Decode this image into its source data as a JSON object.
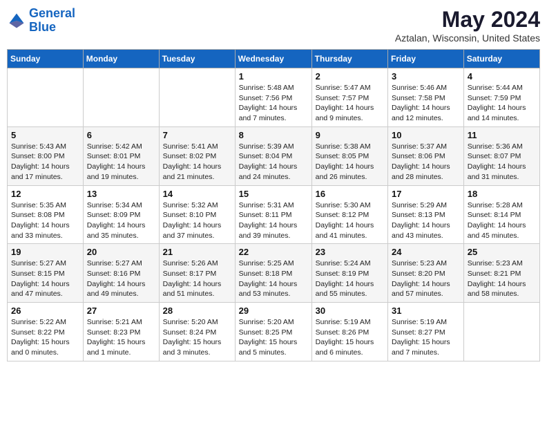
{
  "logo": {
    "line1": "General",
    "line2": "Blue"
  },
  "title": "May 2024",
  "location": "Aztalan, Wisconsin, United States",
  "days_of_week": [
    "Sunday",
    "Monday",
    "Tuesday",
    "Wednesday",
    "Thursday",
    "Friday",
    "Saturday"
  ],
  "weeks": [
    [
      null,
      null,
      null,
      {
        "day": "1",
        "sunrise": "5:48 AM",
        "sunset": "7:56 PM",
        "daylight": "14 hours and 7 minutes."
      },
      {
        "day": "2",
        "sunrise": "5:47 AM",
        "sunset": "7:57 PM",
        "daylight": "14 hours and 9 minutes."
      },
      {
        "day": "3",
        "sunrise": "5:46 AM",
        "sunset": "7:58 PM",
        "daylight": "14 hours and 12 minutes."
      },
      {
        "day": "4",
        "sunrise": "5:44 AM",
        "sunset": "7:59 PM",
        "daylight": "14 hours and 14 minutes."
      }
    ],
    [
      {
        "day": "5",
        "sunrise": "5:43 AM",
        "sunset": "8:00 PM",
        "daylight": "14 hours and 17 minutes."
      },
      {
        "day": "6",
        "sunrise": "5:42 AM",
        "sunset": "8:01 PM",
        "daylight": "14 hours and 19 minutes."
      },
      {
        "day": "7",
        "sunrise": "5:41 AM",
        "sunset": "8:02 PM",
        "daylight": "14 hours and 21 minutes."
      },
      {
        "day": "8",
        "sunrise": "5:39 AM",
        "sunset": "8:04 PM",
        "daylight": "14 hours and 24 minutes."
      },
      {
        "day": "9",
        "sunrise": "5:38 AM",
        "sunset": "8:05 PM",
        "daylight": "14 hours and 26 minutes."
      },
      {
        "day": "10",
        "sunrise": "5:37 AM",
        "sunset": "8:06 PM",
        "daylight": "14 hours and 28 minutes."
      },
      {
        "day": "11",
        "sunrise": "5:36 AM",
        "sunset": "8:07 PM",
        "daylight": "14 hours and 31 minutes."
      }
    ],
    [
      {
        "day": "12",
        "sunrise": "5:35 AM",
        "sunset": "8:08 PM",
        "daylight": "14 hours and 33 minutes."
      },
      {
        "day": "13",
        "sunrise": "5:34 AM",
        "sunset": "8:09 PM",
        "daylight": "14 hours and 35 minutes."
      },
      {
        "day": "14",
        "sunrise": "5:32 AM",
        "sunset": "8:10 PM",
        "daylight": "14 hours and 37 minutes."
      },
      {
        "day": "15",
        "sunrise": "5:31 AM",
        "sunset": "8:11 PM",
        "daylight": "14 hours and 39 minutes."
      },
      {
        "day": "16",
        "sunrise": "5:30 AM",
        "sunset": "8:12 PM",
        "daylight": "14 hours and 41 minutes."
      },
      {
        "day": "17",
        "sunrise": "5:29 AM",
        "sunset": "8:13 PM",
        "daylight": "14 hours and 43 minutes."
      },
      {
        "day": "18",
        "sunrise": "5:28 AM",
        "sunset": "8:14 PM",
        "daylight": "14 hours and 45 minutes."
      }
    ],
    [
      {
        "day": "19",
        "sunrise": "5:27 AM",
        "sunset": "8:15 PM",
        "daylight": "14 hours and 47 minutes."
      },
      {
        "day": "20",
        "sunrise": "5:27 AM",
        "sunset": "8:16 PM",
        "daylight": "14 hours and 49 minutes."
      },
      {
        "day": "21",
        "sunrise": "5:26 AM",
        "sunset": "8:17 PM",
        "daylight": "14 hours and 51 minutes."
      },
      {
        "day": "22",
        "sunrise": "5:25 AM",
        "sunset": "8:18 PM",
        "daylight": "14 hours and 53 minutes."
      },
      {
        "day": "23",
        "sunrise": "5:24 AM",
        "sunset": "8:19 PM",
        "daylight": "14 hours and 55 minutes."
      },
      {
        "day": "24",
        "sunrise": "5:23 AM",
        "sunset": "8:20 PM",
        "daylight": "14 hours and 57 minutes."
      },
      {
        "day": "25",
        "sunrise": "5:23 AM",
        "sunset": "8:21 PM",
        "daylight": "14 hours and 58 minutes."
      }
    ],
    [
      {
        "day": "26",
        "sunrise": "5:22 AM",
        "sunset": "8:22 PM",
        "daylight": "15 hours and 0 minutes."
      },
      {
        "day": "27",
        "sunrise": "5:21 AM",
        "sunset": "8:23 PM",
        "daylight": "15 hours and 1 minute."
      },
      {
        "day": "28",
        "sunrise": "5:20 AM",
        "sunset": "8:24 PM",
        "daylight": "15 hours and 3 minutes."
      },
      {
        "day": "29",
        "sunrise": "5:20 AM",
        "sunset": "8:25 PM",
        "daylight": "15 hours and 5 minutes."
      },
      {
        "day": "30",
        "sunrise": "5:19 AM",
        "sunset": "8:26 PM",
        "daylight": "15 hours and 6 minutes."
      },
      {
        "day": "31",
        "sunrise": "5:19 AM",
        "sunset": "8:27 PM",
        "daylight": "15 hours and 7 minutes."
      },
      null
    ]
  ],
  "labels": {
    "sunrise": "Sunrise:",
    "sunset": "Sunset:",
    "daylight": "Daylight:"
  }
}
